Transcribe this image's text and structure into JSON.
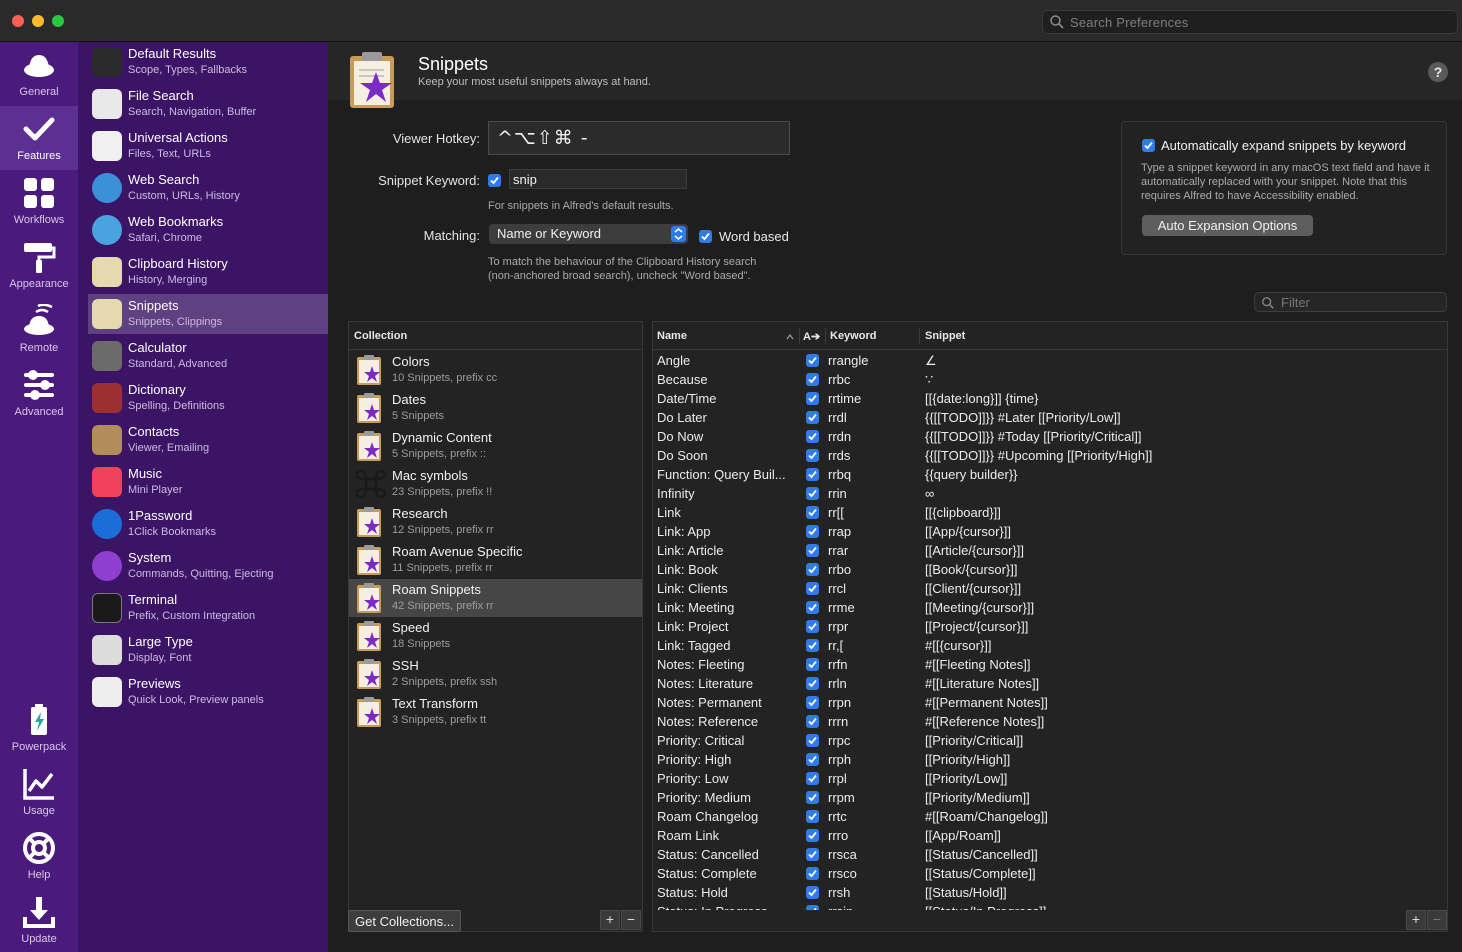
{
  "window": {
    "search_placeholder": "Search Preferences"
  },
  "rail": {
    "top": [
      {
        "label": "General",
        "icon": "cloud-hat-icon"
      },
      {
        "label": "Features",
        "icon": "checkmark-icon"
      },
      {
        "label": "Workflows",
        "icon": "grid-icon"
      },
      {
        "label": "Appearance",
        "icon": "paint-roller-icon"
      },
      {
        "label": "Remote",
        "icon": "remote-icon"
      },
      {
        "label": "Advanced",
        "icon": "sliders-icon"
      }
    ],
    "bottom": [
      {
        "label": "Powerpack",
        "icon": "battery-icon"
      },
      {
        "label": "Usage",
        "icon": "chart-icon"
      },
      {
        "label": "Help",
        "icon": "lifebuoy-icon"
      },
      {
        "label": "Update",
        "icon": "download-icon"
      }
    ]
  },
  "features": [
    {
      "title": "Default Results",
      "sub": "Scope, Types, Fallbacks",
      "color": "#2b2b2b"
    },
    {
      "title": "File Search",
      "sub": "Search, Navigation, Buffer",
      "color": "#e9e9e9"
    },
    {
      "title": "Universal Actions",
      "sub": "Files, Text, URLs",
      "color": "#f0f0f0"
    },
    {
      "title": "Web Search",
      "sub": "Custom, URLs, History",
      "color": "#3a8fd8"
    },
    {
      "title": "Web Bookmarks",
      "sub": "Safari, Chrome",
      "color": "#4aa3df"
    },
    {
      "title": "Clipboard History",
      "sub": "History, Merging",
      "color": "#e6d9b0"
    },
    {
      "title": "Snippets",
      "sub": "Snippets, Clippings",
      "color": "#e6d9b0"
    },
    {
      "title": "Calculator",
      "sub": "Standard, Advanced",
      "color": "#6b6b6b"
    },
    {
      "title": "Dictionary",
      "sub": "Spelling, Definitions",
      "color": "#9c2f2f"
    },
    {
      "title": "Contacts",
      "sub": "Viewer, Emailing",
      "color": "#b08d5a"
    },
    {
      "title": "Music",
      "sub": "Mini Player",
      "color": "#f0435b"
    },
    {
      "title": "1Password",
      "sub": "1Click Bookmarks",
      "color": "#1a6ed8"
    },
    {
      "title": "System",
      "sub": "Commands, Quitting, Ejecting",
      "color": "#8e3fd0"
    },
    {
      "title": "Terminal",
      "sub": "Prefix, Custom Integration",
      "color": "#1a1a1a"
    },
    {
      "title": "Large Type",
      "sub": "Display, Font",
      "color": "#dcdcdc"
    },
    {
      "title": "Previews",
      "sub": "Quick Look, Preview panels",
      "color": "#eeeeee"
    }
  ],
  "header": {
    "title": "Snippets",
    "subtitle": "Keep your most useful snippets always at hand."
  },
  "form": {
    "viewer_hotkey_label": "Viewer Hotkey:",
    "viewer_hotkey_value": "^⌥⇧⌘ -",
    "snippet_keyword_label": "Snippet Keyword:",
    "snippet_keyword_value": "snip",
    "snippet_keyword_hint": "For snippets in Alfred's default results.",
    "matching_label": "Matching:",
    "matching_value": "Name or Keyword",
    "word_based_label": "Word based",
    "matching_hint_1": "To match the behaviour of the Clipboard History search",
    "matching_hint_2": "(non-anchored broad search), uncheck \"Word based\"."
  },
  "auto_expand": {
    "title": "Automatically expand snippets by keyword",
    "desc": "Type a snippet keyword in any macOS text field and have it automatically replaced with your snippet. Note that this requires Alfred to have Accessibility enabled.",
    "button": "Auto Expansion Options"
  },
  "filter_placeholder": "Filter",
  "collections": {
    "header": "Collection",
    "items": [
      {
        "name": "Colors",
        "sub": "10 Snippets, prefix cc"
      },
      {
        "name": "Dates",
        "sub": "5 Snippets"
      },
      {
        "name": "Dynamic Content",
        "sub": "5 Snippets, prefix ::"
      },
      {
        "name": "Mac symbols",
        "sub": "23 Snippets, prefix !!"
      },
      {
        "name": "Research",
        "sub": "12 Snippets, prefix rr"
      },
      {
        "name": "Roam Avenue Specific",
        "sub": "11 Snippets, prefix rr"
      },
      {
        "name": "Roam Snippets",
        "sub": "42 Snippets, prefix rr"
      },
      {
        "name": "Speed",
        "sub": "18 Snippets"
      },
      {
        "name": "SSH",
        "sub": "2 Snippets, prefix ssh"
      },
      {
        "name": "Text Transform",
        "sub": "3 Snippets, prefix tt"
      }
    ],
    "get_button": "Get Collections...",
    "add": "+",
    "remove": "−"
  },
  "table": {
    "headers": {
      "name": "Name",
      "auto": "A➔",
      "keyword": "Keyword",
      "snippet": "Snippet"
    },
    "rows": [
      {
        "name": "Angle",
        "kw": "rrangle",
        "snip": "∠"
      },
      {
        "name": "Because",
        "kw": "rrbc",
        "snip": "∵"
      },
      {
        "name": "Date/Time",
        "kw": "rrtime",
        "snip": "[[{date:long}]] {time}"
      },
      {
        "name": "Do Later",
        "kw": "rrdl",
        "snip": "{{[[TODO]]}} #Later [[Priority/Low]]"
      },
      {
        "name": "Do Now",
        "kw": "rrdn",
        "snip": "{{[[TODO]]}} #Today [[Priority/Critical]]"
      },
      {
        "name": "Do Soon",
        "kw": "rrds",
        "snip": "{{[[TODO]]}} #Upcoming [[Priority/High]]"
      },
      {
        "name": "Function: Query Buil...",
        "kw": "rrbq",
        "snip": "{{query builder}}"
      },
      {
        "name": "Infinity",
        "kw": "rrin",
        "snip": "∞"
      },
      {
        "name": "Link",
        "kw": "rr[[",
        "snip": "[[{clipboard}]]"
      },
      {
        "name": "Link: App",
        "kw": "rrap",
        "snip": "[[App/{cursor}]]"
      },
      {
        "name": "Link: Article",
        "kw": "rrar",
        "snip": "[[Article/{cursor}]]"
      },
      {
        "name": "Link: Book",
        "kw": "rrbo",
        "snip": "[[Book/{cursor}]]"
      },
      {
        "name": "Link: Clients",
        "kw": "rrcl",
        "snip": "[[Client/{cursor}]]"
      },
      {
        "name": "Link: Meeting",
        "kw": "rrme",
        "snip": "[[Meeting/{cursor}]]"
      },
      {
        "name": "Link: Project",
        "kw": "rrpr",
        "snip": "[[Project/{cursor}]]"
      },
      {
        "name": "Link: Tagged",
        "kw": "rr,[",
        "snip": "#[[{cursor}]]"
      },
      {
        "name": "Notes: Fleeting",
        "kw": "rrfn",
        "snip": "#[[Fleeting Notes]]"
      },
      {
        "name": "Notes: Literature",
        "kw": "rrln",
        "snip": "#[[Literature Notes]]"
      },
      {
        "name": "Notes: Permanent",
        "kw": "rrpn",
        "snip": "#[[Permanent Notes]]"
      },
      {
        "name": "Notes: Reference",
        "kw": "rrrn",
        "snip": "#[[Reference Notes]]"
      },
      {
        "name": "Priority: Critical",
        "kw": "rrpc",
        "snip": "[[Priority/Critical]]"
      },
      {
        "name": "Priority: High",
        "kw": "rrph",
        "snip": "[[Priority/High]]"
      },
      {
        "name": "Priority: Low",
        "kw": "rrpl",
        "snip": "[[Priority/Low]]"
      },
      {
        "name": "Priority: Medium",
        "kw": "rrpm",
        "snip": "[[Priority/Medium]]"
      },
      {
        "name": "Roam Changelog",
        "kw": "rrtc",
        "snip": "#[[Roam/Changelog]]"
      },
      {
        "name": "Roam Link",
        "kw": "rrro",
        "snip": "[[App/Roam]]"
      },
      {
        "name": "Status: Cancelled",
        "kw": "rrsca",
        "snip": "[[Status/Cancelled]]"
      },
      {
        "name": "Status: Complete",
        "kw": "rrsco",
        "snip": "[[Status/Complete]]"
      },
      {
        "name": "Status: Hold",
        "kw": "rrsh",
        "snip": "[[Status/Hold]]"
      },
      {
        "name": "Status: In Progress",
        "kw": "rrsip",
        "snip": "[[Status/In Progress]]"
      }
    ],
    "add": "+",
    "remove": "−"
  },
  "colors": {
    "rail": "#4a1b7d",
    "features_bg": "#3c1466",
    "accent": "#2f7be9"
  }
}
